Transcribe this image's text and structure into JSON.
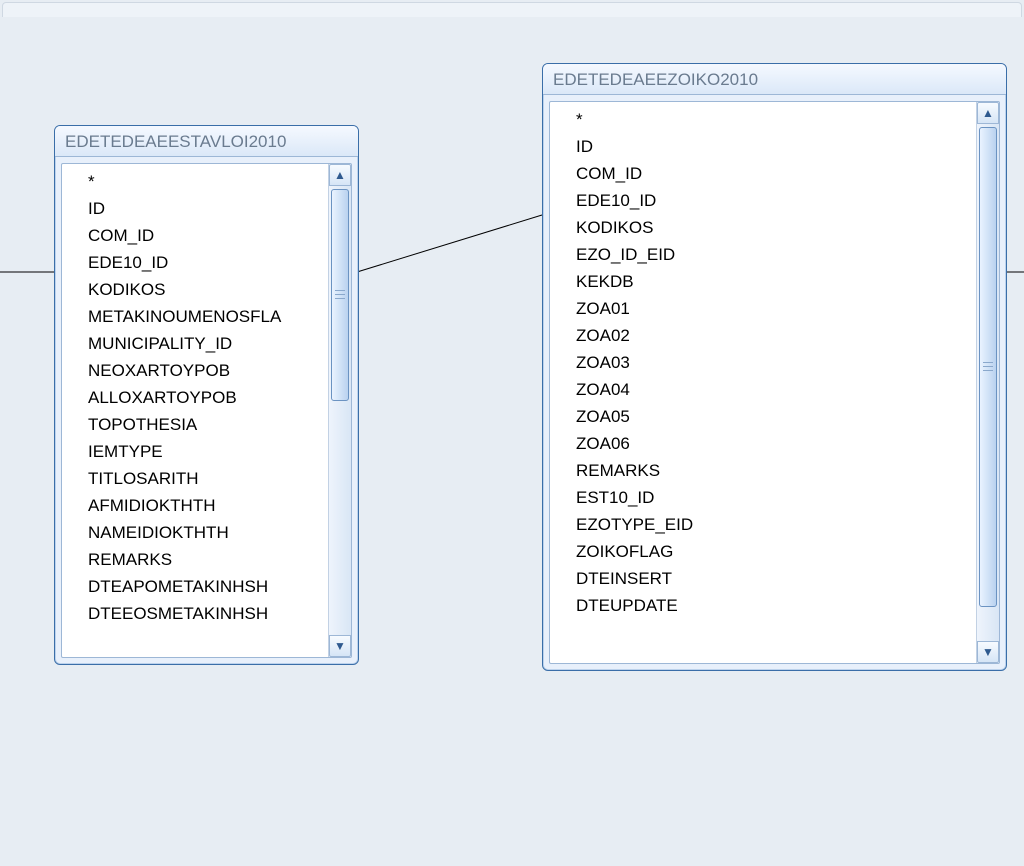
{
  "tables": [
    {
      "title": "EDETEDEAEESTAVLOI2010",
      "columns": [
        "*",
        "ID",
        "COM_ID",
        "EDE10_ID",
        "KODIKOS",
        "METAKINOUMENOSFLA",
        "MUNICIPALITY_ID",
        "NEOXARTOYPOB",
        "ALLOXARTOYPOB",
        "TOPOTHESIA",
        "IEMTYPE",
        "TITLOSARITH",
        "AFMIDIOKTHTH",
        "NAMEIDIOKTHTH",
        "REMARKS",
        "DTEAPOMETAKINHSH",
        "DTEEOSMETAKINHSH"
      ]
    },
    {
      "title": "EDETEDEAEEZOIKO2010",
      "columns": [
        "*",
        "ID",
        "COM_ID",
        "EDE10_ID",
        "KODIKOS",
        "EZO_ID_EID",
        "KEKDB",
        "ZOA01",
        "ZOA02",
        "ZOA03",
        "ZOA04",
        "ZOA05",
        "ZOA06",
        "REMARKS",
        "EST10_ID",
        "EZOTYPE_EID",
        "ZOIKOFLAG",
        "DTEINSERT",
        "DTEUPDATE"
      ]
    }
  ]
}
